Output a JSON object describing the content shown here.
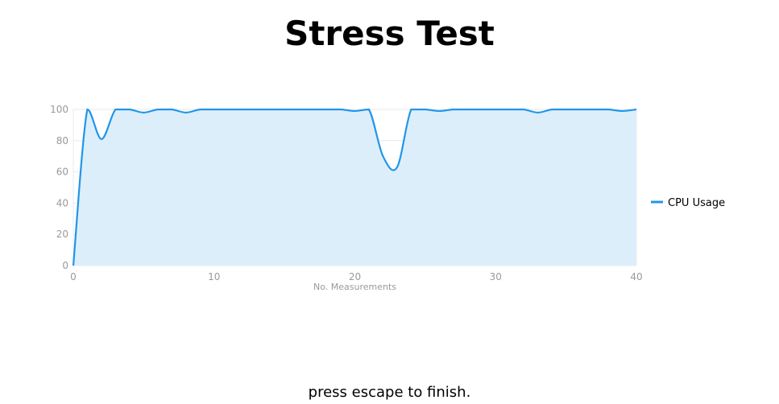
{
  "page": {
    "title": "Stress Test",
    "footer_hint": "press escape to finish."
  },
  "colors": {
    "line": "#2196e8",
    "area": "#ddeefb",
    "grid": "#e4eaf0",
    "tick_text": "#999999",
    "legend_text": "#000000"
  },
  "chart_data": {
    "type": "area",
    "title": "",
    "xlabel": "No. Measurements",
    "ylabel": "",
    "xlim": [
      0,
      40
    ],
    "ylim": [
      0,
      100
    ],
    "xticks": [
      0,
      10,
      20,
      30,
      40
    ],
    "yticks": [
      0,
      20,
      40,
      60,
      80,
      100
    ],
    "grid": true,
    "legend_position": "right",
    "series": [
      {
        "name": "CPU Usage",
        "x": [
          0,
          1,
          2,
          3,
          4,
          5,
          6,
          7,
          8,
          9,
          10,
          11,
          12,
          13,
          14,
          15,
          16,
          17,
          18,
          19,
          20,
          21,
          22,
          23,
          24,
          25,
          26,
          27,
          28,
          29,
          30,
          31,
          32,
          33,
          34,
          35,
          36,
          37,
          38,
          39,
          40
        ],
        "values": [
          0,
          100,
          81,
          100,
          100,
          98,
          100,
          100,
          98,
          100,
          100,
          100,
          100,
          100,
          100,
          100,
          100,
          100,
          100,
          100,
          99,
          100,
          70,
          63,
          100,
          100,
          99,
          100,
          100,
          100,
          100,
          100,
          100,
          98,
          100,
          100,
          100,
          100,
          100,
          99,
          100
        ]
      }
    ]
  }
}
